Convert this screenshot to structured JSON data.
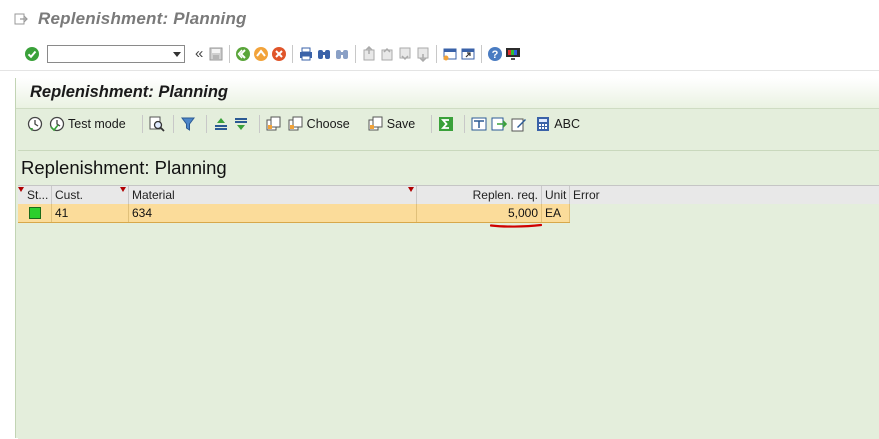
{
  "window": {
    "title": "Replenishment: Planning"
  },
  "system_toolbar": {
    "command_field_value": "",
    "command_field_placeholder": "",
    "back_chevrons": "«",
    "icons": [
      "enter-icon",
      "save-icon",
      "back-icon",
      "exit-icon",
      "cancel-icon",
      "print-icon",
      "find-icon",
      "find-next-icon",
      "first-page-icon",
      "previous-page-icon",
      "next-page-icon",
      "last-page-icon",
      "new-session-icon",
      "shortcut-icon",
      "help-icon",
      "customize-layout-icon"
    ]
  },
  "app": {
    "title": "Replenishment: Planning",
    "toolbar": {
      "test_mode_label": "Test mode",
      "choose_label": "Choose",
      "save_label": "Save",
      "abc_label": "ABC"
    }
  },
  "grid": {
    "title": "Replenishment: Planning",
    "columns": [
      "St...",
      "Cust.",
      "Material",
      "Replen. req.",
      "Unit",
      "Error"
    ],
    "rows": [
      {
        "status": "green",
        "cust": "41",
        "material": "634",
        "replen_req": "5,000",
        "unit": "EA",
        "error": ""
      }
    ]
  },
  "colors": {
    "content_bg": "#e4eedc",
    "selected_row": "#fbdc9a",
    "status_ok": "#2ccf2c",
    "annotation": "#d00000"
  }
}
